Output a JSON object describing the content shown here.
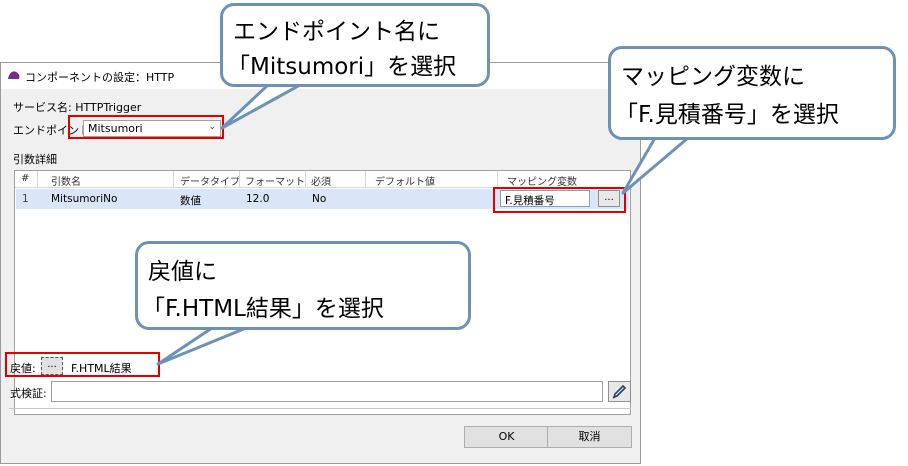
{
  "dialog": {
    "title": "コンポーネントの設定：HTTP",
    "service_label": "サービス名: HTTPTrigger",
    "endpoint_label": "エンドポイント名:",
    "endpoint_value": "Mitsumori",
    "args_section_label": "引数詳細",
    "columns": [
      "#",
      "引数名",
      "データタイプ",
      "フォーマット",
      "必須",
      "デフォルト値",
      "マッピング変数"
    ],
    "rows": [
      {
        "num": "1",
        "name": "MitsumoriNo",
        "type": "数値",
        "format": "12.0",
        "required": "No",
        "default": "",
        "mapping": "F.見積番号"
      }
    ],
    "browse_label": "...",
    "return_label": "戻値:",
    "return_value": "F.HTML結果",
    "expr_label": "式検証:",
    "expr_value": "",
    "ok_label": "OK",
    "cancel_label": "取消"
  },
  "callouts": {
    "endpoint": {
      "line1": "エンドポイント名に",
      "line2": "「Mitsumori」を選択"
    },
    "mapping": {
      "line1": "マッピング変数に",
      "line2": "「F.見積番号」を選択"
    },
    "return": {
      "line1": "戻値に",
      "line2": "「F.HTML結果」を選択"
    }
  },
  "colors": {
    "callout_border": "#6e92b6",
    "highlight_red": "#e00000",
    "row_selected": "#d9e6f7"
  },
  "icons": {
    "app": "app-logo-icon",
    "dropdown": "chevron-down-icon",
    "edit": "pencil-icon"
  }
}
